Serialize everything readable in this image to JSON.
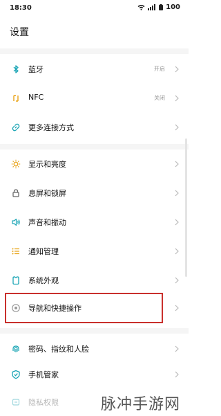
{
  "status": {
    "time": "18:30",
    "battery": "100"
  },
  "title": "设置",
  "items": [
    {
      "label": "蓝牙",
      "value": "开启",
      "icon": "bluetooth-icon"
    },
    {
      "label": "NFC",
      "value": "关闭",
      "icon": "nfc-icon"
    },
    {
      "label": "更多连接方式",
      "value": "",
      "icon": "link-icon"
    },
    {
      "label": "显示和亮度",
      "value": "",
      "icon": "sun-icon"
    },
    {
      "label": "息屏和锁屏",
      "value": "",
      "icon": "lock-icon"
    },
    {
      "label": "声音和振动",
      "value": "",
      "icon": "speaker-icon"
    },
    {
      "label": "通知管理",
      "value": "",
      "icon": "list-icon"
    },
    {
      "label": "系统外观",
      "value": "",
      "icon": "appearance-icon"
    },
    {
      "label": "导航和快捷操作",
      "value": "",
      "icon": "navigation-icon"
    },
    {
      "label": "密码、指纹和人脸",
      "value": "",
      "icon": "fingerprint-icon"
    },
    {
      "label": "手机管家",
      "value": "",
      "icon": "shield-icon"
    },
    {
      "label": "隐私权限",
      "value": "",
      "icon": "privacy-icon"
    }
  ],
  "colors": {
    "accent": "#1aa5b5",
    "highlight": "#c9302c"
  },
  "watermark": "脉冲手游网"
}
